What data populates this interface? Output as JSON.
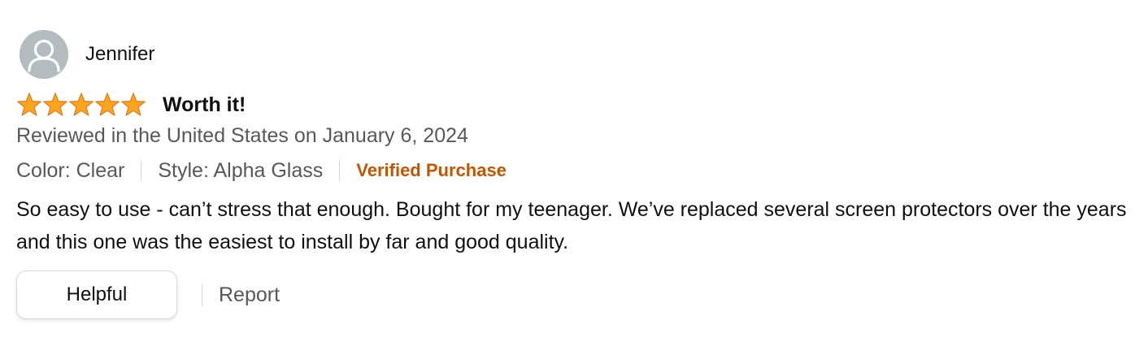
{
  "profile": {
    "name": "Jennifer",
    "avatar_icon": "default-user-avatar-icon"
  },
  "review": {
    "rating": 5,
    "rating_max": 5,
    "star_color": "#ffa41c",
    "title": "Worth it!",
    "date_text": "Reviewed in the United States on January 6, 2024",
    "format": {
      "color": "Color: Clear",
      "style": "Style: Alpha Glass"
    },
    "verified_label": "Verified Purchase",
    "verified_color": "#c45500",
    "body": "So easy to use - can’t stress that enough. Bought for my teenager. We’ve replaced several screen protectors over the years and this one was the easiest to install by far and good quality."
  },
  "actions": {
    "helpful_label": "Helpful",
    "report_label": "Report"
  }
}
